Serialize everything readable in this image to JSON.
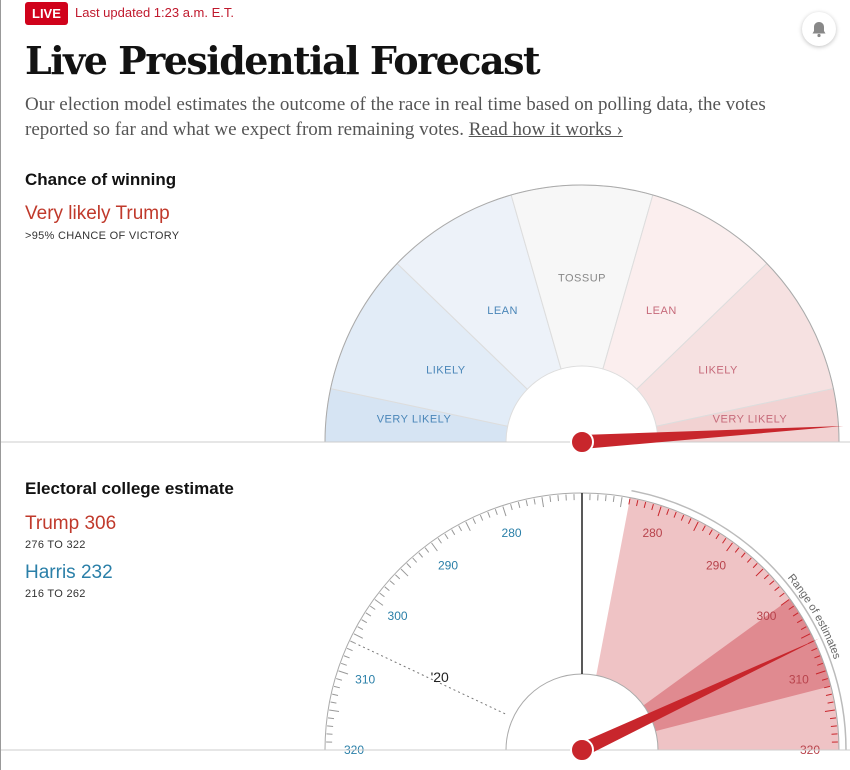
{
  "header": {
    "live_badge": "LIVE",
    "last_updated": "Last updated 1:23 a.m. E.T.",
    "title": "Live Presidential Forecast",
    "intro": "Our election model estimates the outcome of the race in real time based on polling data, the votes reported so far and what we expect from remaining votes.",
    "read_more": "Read how it works ›"
  },
  "chance": {
    "title": "Chance of winning",
    "headline": "Very likely Trump",
    "sub": ">95% CHANCE OF VICTORY"
  },
  "electoral": {
    "title": "Electoral college estimate",
    "trump": "Trump 306",
    "trump_range": "276 TO 322",
    "harris": "Harris 232",
    "harris_range": "216 TO 262"
  },
  "colors": {
    "trump": "#c0392b",
    "harris": "#2a7fa8",
    "live": "#d0021b"
  },
  "chart_data": [
    {
      "type": "gauge",
      "name": "chance-of-winning",
      "segments": [
        {
          "label": "VERY LIKELY",
          "side": "Harris",
          "color": "#d6e4f3"
        },
        {
          "label": "LIKELY",
          "side": "Harris",
          "color": "#e2ecf7"
        },
        {
          "label": "LEAN",
          "side": "Harris",
          "color": "#edf2f9"
        },
        {
          "label": "TOSSUP",
          "side": "",
          "color": "#f7f7f7"
        },
        {
          "label": "LEAN",
          "side": "Trump",
          "color": "#fbeeee"
        },
        {
          "label": "LIKELY",
          "side": "Trump",
          "color": "#f6e1e1"
        },
        {
          "label": "VERY LIKELY",
          "side": "Trump",
          "color": "#f2d2d2"
        }
      ],
      "needle": "Very likely Trump",
      "trump_chance_pct": 97
    },
    {
      "type": "gauge",
      "name": "electoral-college",
      "tick_labels_left": [
        280,
        290,
        300,
        310,
        320
      ],
      "tick_labels_right": [
        280,
        290,
        300,
        310,
        320
      ],
      "center_value": 270,
      "scale_min": 220,
      "scale_max": 320,
      "trump_estimate": 306,
      "trump_range": [
        276,
        322
      ],
      "likely_band": [
        300,
        312
      ],
      "previous": {
        "label": "'20",
        "value": 306,
        "side": "Harris"
      },
      "range_label": "Range of estimates"
    }
  ]
}
